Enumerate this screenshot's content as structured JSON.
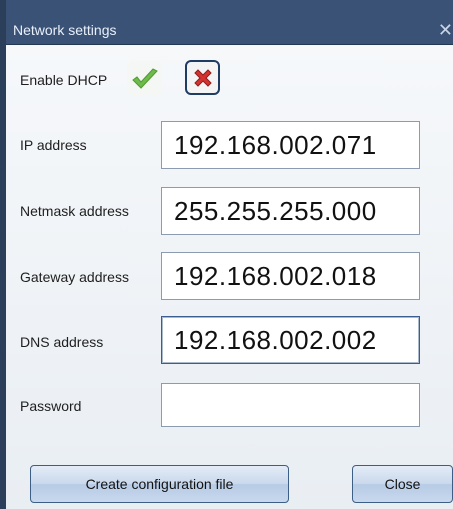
{
  "window": {
    "title": "Network settings",
    "close_glyph": "✕"
  },
  "dhcp": {
    "label": "Enable DHCP",
    "enable_icon": "check-icon",
    "disable_icon": "cross-icon",
    "selected": "disabled"
  },
  "fields": {
    "ip": {
      "label": "IP address",
      "value": "192.168.002.071"
    },
    "netmask": {
      "label": "Netmask address",
      "value": "255.255.255.000"
    },
    "gateway": {
      "label": "Gateway address",
      "value": "192.168.002.018"
    },
    "dns": {
      "label": "DNS address",
      "value": "192.168.002.002"
    },
    "password": {
      "label": "Password",
      "value": ""
    }
  },
  "buttons": {
    "create": "Create configuration file",
    "close": "Close"
  },
  "colors": {
    "titlebar": "#3a5275",
    "check_green": "#6dbb4a",
    "cross_red": "#d4322f"
  }
}
